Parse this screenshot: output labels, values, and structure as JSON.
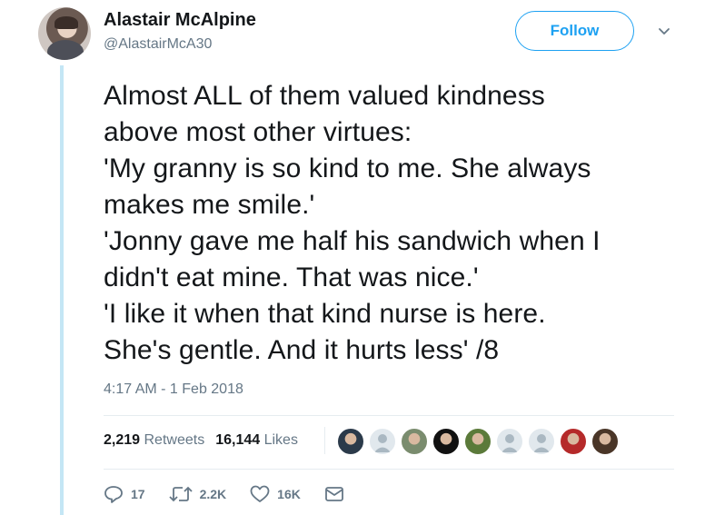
{
  "author": {
    "name": "Alastair McAlpine",
    "handle": "@AlastairMcA30"
  },
  "follow_button": {
    "label": "Follow"
  },
  "tweet": {
    "lines": [
      "Almost ALL of them valued kindness",
      "above most other virtues:",
      "'My granny is so kind to me. She always",
      "makes me smile.'",
      "'Jonny gave me half his sandwich when I",
      "didn't eat mine. That was nice.'",
      "'I like it when that kind nurse is here.",
      "She's gentle. And it hurts less' /8"
    ],
    "timestamp": "4:17 AM - 1 Feb 2018"
  },
  "stats": {
    "retweets_count": "2,219",
    "retweets_label": "Retweets",
    "likes_count": "16,144",
    "likes_label": "Likes"
  },
  "liker_avatars": [
    {
      "icon": "user-photo",
      "color": "#2b3a4a"
    },
    {
      "icon": "default-avatar",
      "color": "#aab8c2"
    },
    {
      "icon": "user-photo",
      "color": "#7a8c6e"
    },
    {
      "icon": "user-photo",
      "color": "#111111"
    },
    {
      "icon": "user-photo",
      "color": "#5b7a3a"
    },
    {
      "icon": "default-avatar",
      "color": "#aab8c2"
    },
    {
      "icon": "default-avatar",
      "color": "#aab8c2"
    },
    {
      "icon": "user-photo",
      "color": "#b52a2a"
    },
    {
      "icon": "user-photo",
      "color": "#4a3628"
    }
  ],
  "actions": {
    "reply_count": "17",
    "retweet_count": "2.2K",
    "like_count": "16K"
  },
  "colors": {
    "accent": "#1da1f2",
    "secondary_text": "#657786",
    "thread_line": "#c4e6f5"
  }
}
